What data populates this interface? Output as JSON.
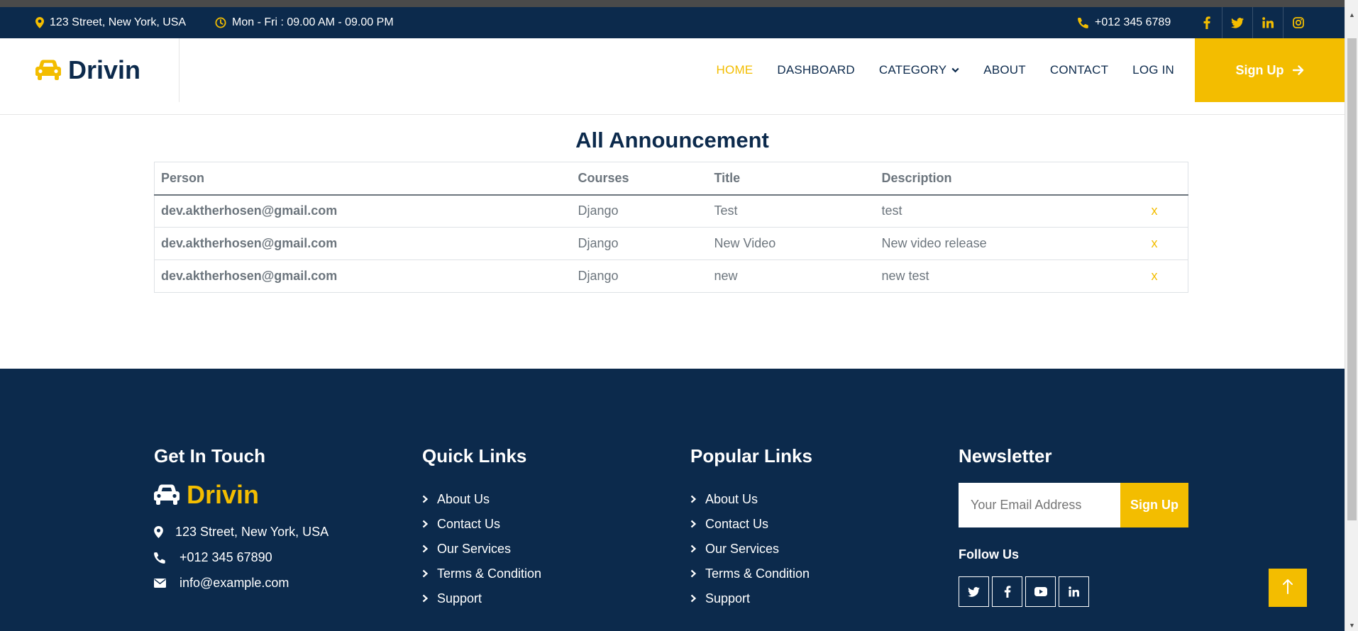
{
  "topbar": {
    "address": "123 Street, New York, USA",
    "hours": "Mon - Fri : 09.00 AM - 09.00 PM",
    "phone": "+012 345 6789",
    "social": [
      "facebook-icon",
      "twitter-icon",
      "linkedin-icon",
      "instagram-icon"
    ]
  },
  "brand": {
    "name": "Drivin"
  },
  "nav": {
    "items": [
      "HOME",
      "DASHBOARD",
      "CATEGORY",
      "ABOUT",
      "CONTACT",
      "LOG IN"
    ],
    "active": "HOME",
    "signup_label": "Sign Up"
  },
  "main": {
    "title": "All Announcement",
    "table": {
      "headers": [
        "Person",
        "Courses",
        "Title",
        "Description"
      ],
      "rows": [
        {
          "person": "dev.aktherhosen@gmail.com",
          "course": "Django",
          "title": "Test",
          "description": "test",
          "action": "x"
        },
        {
          "person": "dev.aktherhosen@gmail.com",
          "course": "Django",
          "title": "New Video",
          "description": "New video release",
          "action": "x"
        },
        {
          "person": "dev.aktherhosen@gmail.com",
          "course": "Django",
          "title": "new",
          "description": "new test",
          "action": "x"
        }
      ]
    }
  },
  "footer": {
    "get_in_touch": {
      "heading": "Get In Touch",
      "brand": "Drivin",
      "address": "123 Street, New York, USA",
      "phone": "+012 345 67890",
      "email": "info@example.com"
    },
    "quick_links": {
      "heading": "Quick Links",
      "items": [
        "About Us",
        "Contact Us",
        "Our Services",
        "Terms & Condition",
        "Support"
      ]
    },
    "popular_links": {
      "heading": "Popular Links",
      "items": [
        "About Us",
        "Contact Us",
        "Our Services",
        "Terms & Condition",
        "Support"
      ]
    },
    "newsletter": {
      "heading": "Newsletter",
      "placeholder": "Your Email Address",
      "button": "Sign Up",
      "follow_label": "Follow Us",
      "social": [
        "twitter-icon",
        "facebook-icon",
        "youtube-icon",
        "linkedin-icon"
      ]
    }
  },
  "colors": {
    "primary": "#f3bd00",
    "dark": "#0c2a4c",
    "text": "#6c757d"
  }
}
